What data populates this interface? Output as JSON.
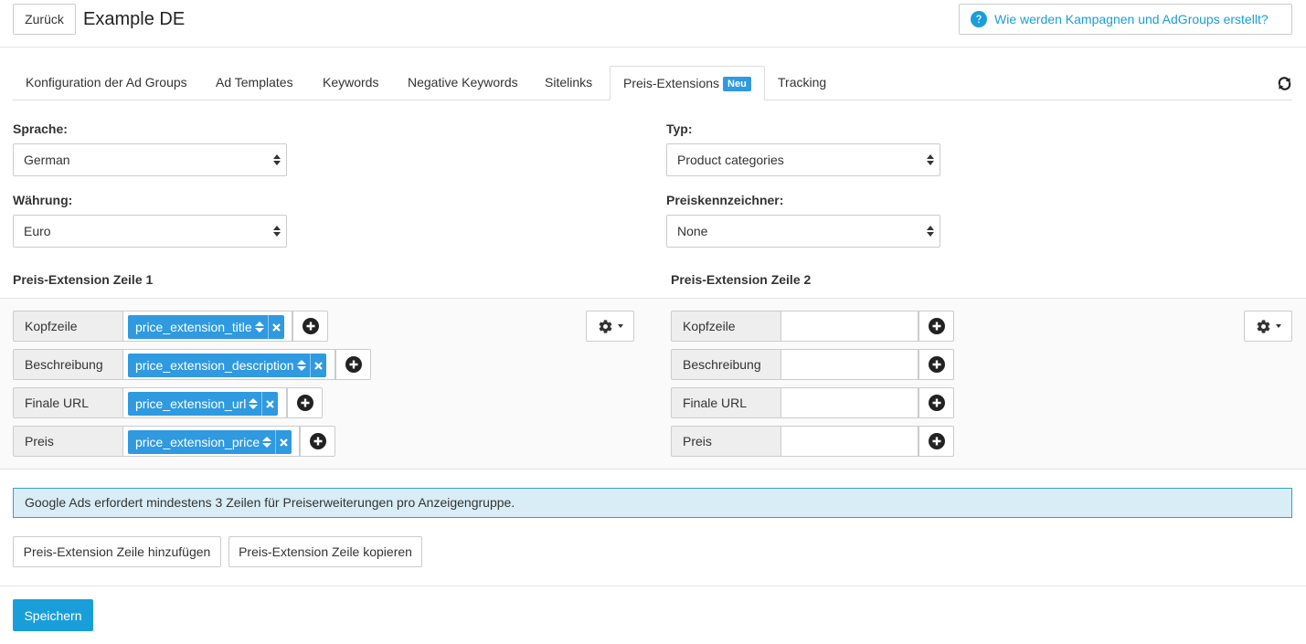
{
  "header": {
    "back_label": "Zurück",
    "title": "Example DE",
    "help_link": "Wie werden Kampagnen und AdGroups erstellt?"
  },
  "tabs": [
    {
      "label": "Konfiguration der Ad Groups"
    },
    {
      "label": "Ad Templates"
    },
    {
      "label": "Keywords"
    },
    {
      "label": "Negative Keywords"
    },
    {
      "label": "Sitelinks"
    },
    {
      "label": "Preis-Extensions",
      "badge": "Neu",
      "active": true
    },
    {
      "label": "Tracking"
    }
  ],
  "form": {
    "sprache": {
      "label": "Sprache:",
      "value": "German"
    },
    "typ": {
      "label": "Typ:",
      "value": "Product categories"
    },
    "waehrung": {
      "label": "Währung:",
      "value": "Euro"
    },
    "preiskennzeichner": {
      "label": "Preiskennzeichner:",
      "value": "None"
    }
  },
  "rows": [
    {
      "title": "Preis-Extension Zeile 1",
      "fields": [
        {
          "label": "Kopfzeile",
          "tag": "price_extension_title"
        },
        {
          "label": "Beschreibung",
          "tag": "price_extension_description"
        },
        {
          "label": "Finale URL",
          "tag": "price_extension_url"
        },
        {
          "label": "Preis",
          "tag": "price_extension_price"
        }
      ]
    },
    {
      "title": "Preis-Extension Zeile 2",
      "fields": [
        {
          "label": "Kopfzeile",
          "tag": ""
        },
        {
          "label": "Beschreibung",
          "tag": ""
        },
        {
          "label": "Finale URL",
          "tag": ""
        },
        {
          "label": "Preis",
          "tag": ""
        }
      ]
    }
  ],
  "info_message": "Google Ads erfordert mindestens 3 Zeilen für Preiserweiterungen pro Anzeigengruppe.",
  "actions": {
    "add_row": "Preis-Extension Zeile hinzufügen",
    "copy_row": "Preis-Extension Zeile kopieren",
    "save": "Speichern"
  },
  "icons": {
    "help": "question-circle-icon",
    "refresh": "refresh-icon",
    "remove": "times-icon",
    "add": "plus-circle-icon",
    "settings": "gear-icon",
    "sort": "sort-icon"
  },
  "colors": {
    "accent": "#2f9ae0",
    "save_button": "#1a9ed9",
    "info_bg": "#d9edf7",
    "info_border": "#31a0d0"
  }
}
